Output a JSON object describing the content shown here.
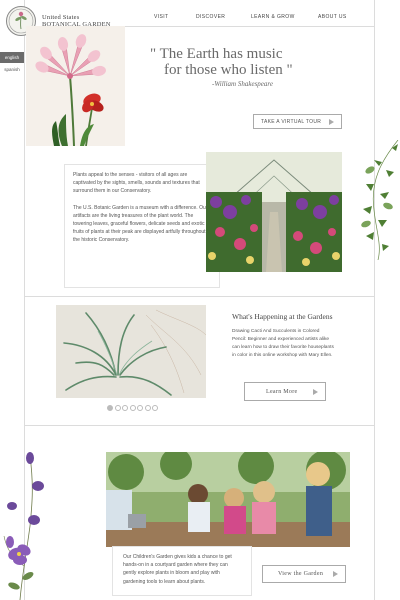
{
  "brand": {
    "line1": "United States",
    "line2": "BOTANICAL GARDEN"
  },
  "nav": [
    {
      "label": "VISIT"
    },
    {
      "label": "DISCOVER"
    },
    {
      "label": "LEARN & GROW"
    },
    {
      "label": "ABOUT US"
    }
  ],
  "languages": {
    "active": "english",
    "inactive": "spanish"
  },
  "hero": {
    "quote_line1": "\" The Earth has music",
    "quote_line2": "for those who listen \"",
    "attribution": "-William Shakespeare",
    "tour_button": "TAKE A VIRTUAL TOUR"
  },
  "intro": {
    "p1": "Plants appeal to the senses - visitors of all ages are captivated by the sights, smells, sounds and textures that surround them in our Conservatory.",
    "p2": "The U.S. Botanic Garden is a museum with a difference. Our artifacts are the living treasures of the plant world. The towering leaves, graceful flowers, delicate seeds and exotic fruits of plants at their peak are displayed artfully throughout the historic Conservatory."
  },
  "events": {
    "title": "What's Happening at the Gardens",
    "body": "Drawing Cacti And Succulents in Colored Pencil: Beginner and experienced artists alike can learn how to draw their favorite houseplants in color in this online workshop with Mary Ellen.",
    "button": "Learn More",
    "carousel_slides": 7,
    "carousel_active": 1
  },
  "children": {
    "body": "Our Children's Garden gives kids a chance to get hands-on in a courtyard garden where they can gently explore plants in bloom and play with gardening tools to learn about plants.",
    "button": "View the Garden"
  },
  "colors": {
    "accent_gray": "#6b6b6b",
    "line": "#dcdcdc"
  }
}
